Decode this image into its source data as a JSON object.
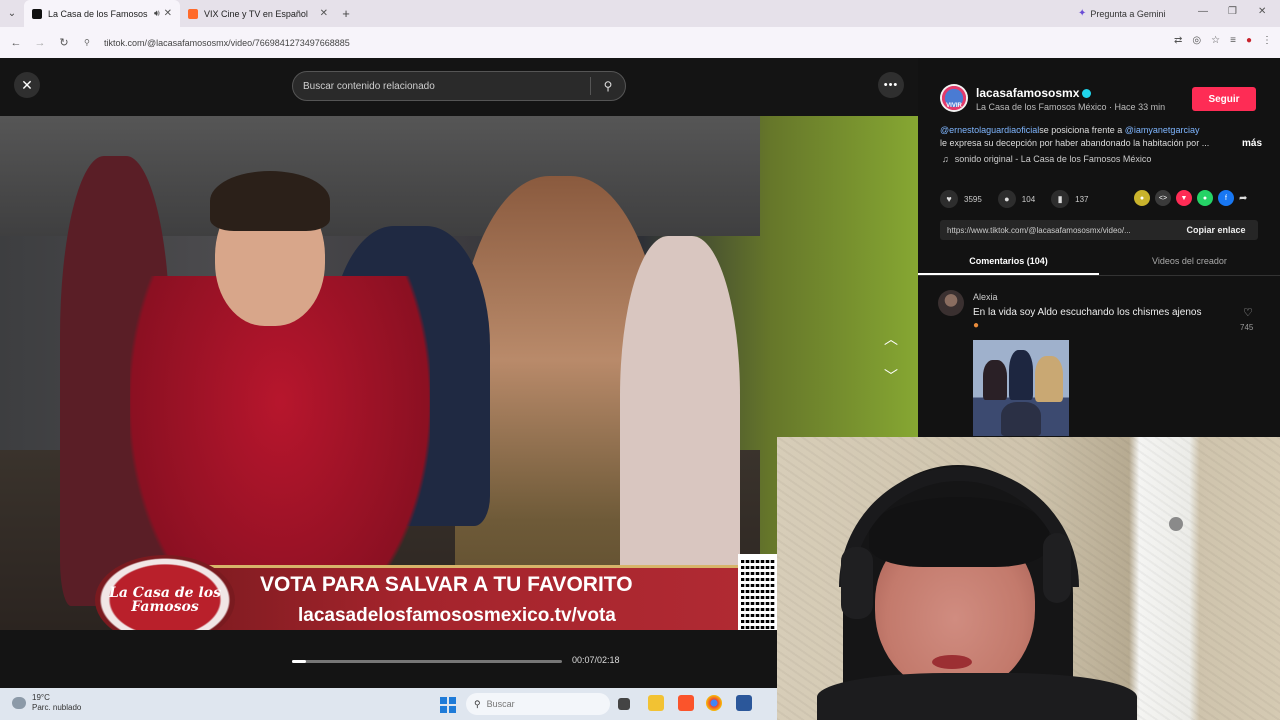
{
  "browser": {
    "tabs": [
      {
        "title": "La Casa de los Famosos M",
        "active": true,
        "favicon_color": "#111111",
        "audio": true
      },
      {
        "title": "VIX Cine y TV en Español",
        "active": false,
        "favicon_color": "#ff6a2a"
      }
    ],
    "gemini_label": "Pregunta a Gemini",
    "url": "tiktok.com/@lacasafamososmx/video/7669841273497668885"
  },
  "viewer": {
    "search_placeholder": "Buscar contenido relacionado",
    "banner_line1": "VOTA PARA SALVAR A TU FAVORITO",
    "banner_line2": "lacasadelosfamososmexico.tv/vota",
    "logo_text": "La Casa de los Famosos",
    "timecode": "00:07/02:18",
    "progress_fraction": 0.05
  },
  "panel": {
    "username": "lacasafamososmx",
    "avatar_text": "VIVIR",
    "submeta": "La Casa de los Famosos México · Hace 33 min",
    "follow_label": "Seguir",
    "desc_mention1": "@ernestolaguardiaoficial",
    "desc_part1": "se posiciona frente a",
    "desc_mention2": "@iamyanetgarciay",
    "desc_part2": "le expresa su decepción por haber abandonado la habitación por ...",
    "more_label": "más",
    "sound": "sonido original - La Casa de los Famosos México",
    "likes": "3595",
    "comments": "104",
    "saves": "137",
    "link": "https://www.tiktok.com/@lacasafamososmx/video/...",
    "copy_label": "Copiar enlace",
    "tab_comments": "Comentarios (104)",
    "tab_videos": "Videos del creador",
    "comment": {
      "author": "Alexia",
      "text": "En la vida soy Aldo escuchando los chismes ajenos",
      "likes": "745"
    }
  },
  "taskbar": {
    "weather_temp": "19°C",
    "weather_desc": "Parc. nublado",
    "search_placeholder": "Buscar"
  }
}
